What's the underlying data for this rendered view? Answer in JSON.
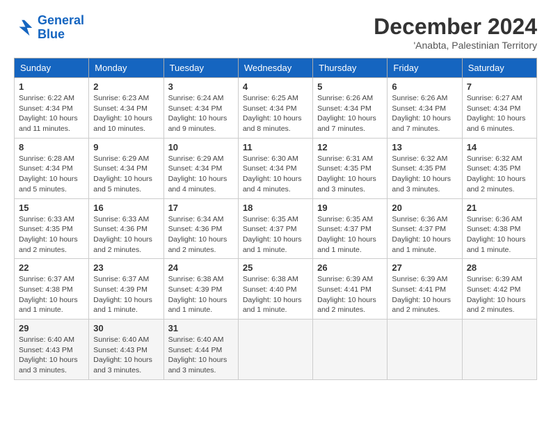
{
  "header": {
    "logo_line1": "General",
    "logo_line2": "Blue",
    "month_title": "December 2024",
    "subtitle": "'Anabta, Palestinian Territory"
  },
  "weekdays": [
    "Sunday",
    "Monday",
    "Tuesday",
    "Wednesday",
    "Thursday",
    "Friday",
    "Saturday"
  ],
  "weeks": [
    [
      {
        "day": "1",
        "sunrise": "6:22 AM",
        "sunset": "4:34 PM",
        "daylight": "10 hours and 11 minutes."
      },
      {
        "day": "2",
        "sunrise": "6:23 AM",
        "sunset": "4:34 PM",
        "daylight": "10 hours and 10 minutes."
      },
      {
        "day": "3",
        "sunrise": "6:24 AM",
        "sunset": "4:34 PM",
        "daylight": "10 hours and 9 minutes."
      },
      {
        "day": "4",
        "sunrise": "6:25 AM",
        "sunset": "4:34 PM",
        "daylight": "10 hours and 8 minutes."
      },
      {
        "day": "5",
        "sunrise": "6:26 AM",
        "sunset": "4:34 PM",
        "daylight": "10 hours and 7 minutes."
      },
      {
        "day": "6",
        "sunrise": "6:26 AM",
        "sunset": "4:34 PM",
        "daylight": "10 hours and 7 minutes."
      },
      {
        "day": "7",
        "sunrise": "6:27 AM",
        "sunset": "4:34 PM",
        "daylight": "10 hours and 6 minutes."
      }
    ],
    [
      {
        "day": "8",
        "sunrise": "6:28 AM",
        "sunset": "4:34 PM",
        "daylight": "10 hours and 5 minutes."
      },
      {
        "day": "9",
        "sunrise": "6:29 AM",
        "sunset": "4:34 PM",
        "daylight": "10 hours and 5 minutes."
      },
      {
        "day": "10",
        "sunrise": "6:29 AM",
        "sunset": "4:34 PM",
        "daylight": "10 hours and 4 minutes."
      },
      {
        "day": "11",
        "sunrise": "6:30 AM",
        "sunset": "4:34 PM",
        "daylight": "10 hours and 4 minutes."
      },
      {
        "day": "12",
        "sunrise": "6:31 AM",
        "sunset": "4:35 PM",
        "daylight": "10 hours and 3 minutes."
      },
      {
        "day": "13",
        "sunrise": "6:32 AM",
        "sunset": "4:35 PM",
        "daylight": "10 hours and 3 minutes."
      },
      {
        "day": "14",
        "sunrise": "6:32 AM",
        "sunset": "4:35 PM",
        "daylight": "10 hours and 2 minutes."
      }
    ],
    [
      {
        "day": "15",
        "sunrise": "6:33 AM",
        "sunset": "4:35 PM",
        "daylight": "10 hours and 2 minutes."
      },
      {
        "day": "16",
        "sunrise": "6:33 AM",
        "sunset": "4:36 PM",
        "daylight": "10 hours and 2 minutes."
      },
      {
        "day": "17",
        "sunrise": "6:34 AM",
        "sunset": "4:36 PM",
        "daylight": "10 hours and 2 minutes."
      },
      {
        "day": "18",
        "sunrise": "6:35 AM",
        "sunset": "4:37 PM",
        "daylight": "10 hours and 1 minute."
      },
      {
        "day": "19",
        "sunrise": "6:35 AM",
        "sunset": "4:37 PM",
        "daylight": "10 hours and 1 minute."
      },
      {
        "day": "20",
        "sunrise": "6:36 AM",
        "sunset": "4:37 PM",
        "daylight": "10 hours and 1 minute."
      },
      {
        "day": "21",
        "sunrise": "6:36 AM",
        "sunset": "4:38 PM",
        "daylight": "10 hours and 1 minute."
      }
    ],
    [
      {
        "day": "22",
        "sunrise": "6:37 AM",
        "sunset": "4:38 PM",
        "daylight": "10 hours and 1 minute."
      },
      {
        "day": "23",
        "sunrise": "6:37 AM",
        "sunset": "4:39 PM",
        "daylight": "10 hours and 1 minute."
      },
      {
        "day": "24",
        "sunrise": "6:38 AM",
        "sunset": "4:39 PM",
        "daylight": "10 hours and 1 minute."
      },
      {
        "day": "25",
        "sunrise": "6:38 AM",
        "sunset": "4:40 PM",
        "daylight": "10 hours and 1 minute."
      },
      {
        "day": "26",
        "sunrise": "6:39 AM",
        "sunset": "4:41 PM",
        "daylight": "10 hours and 2 minutes."
      },
      {
        "day": "27",
        "sunrise": "6:39 AM",
        "sunset": "4:41 PM",
        "daylight": "10 hours and 2 minutes."
      },
      {
        "day": "28",
        "sunrise": "6:39 AM",
        "sunset": "4:42 PM",
        "daylight": "10 hours and 2 minutes."
      }
    ],
    [
      {
        "day": "29",
        "sunrise": "6:40 AM",
        "sunset": "4:43 PM",
        "daylight": "10 hours and 3 minutes."
      },
      {
        "day": "30",
        "sunrise": "6:40 AM",
        "sunset": "4:43 PM",
        "daylight": "10 hours and 3 minutes."
      },
      {
        "day": "31",
        "sunrise": "6:40 AM",
        "sunset": "4:44 PM",
        "daylight": "10 hours and 3 minutes."
      },
      null,
      null,
      null,
      null
    ]
  ]
}
